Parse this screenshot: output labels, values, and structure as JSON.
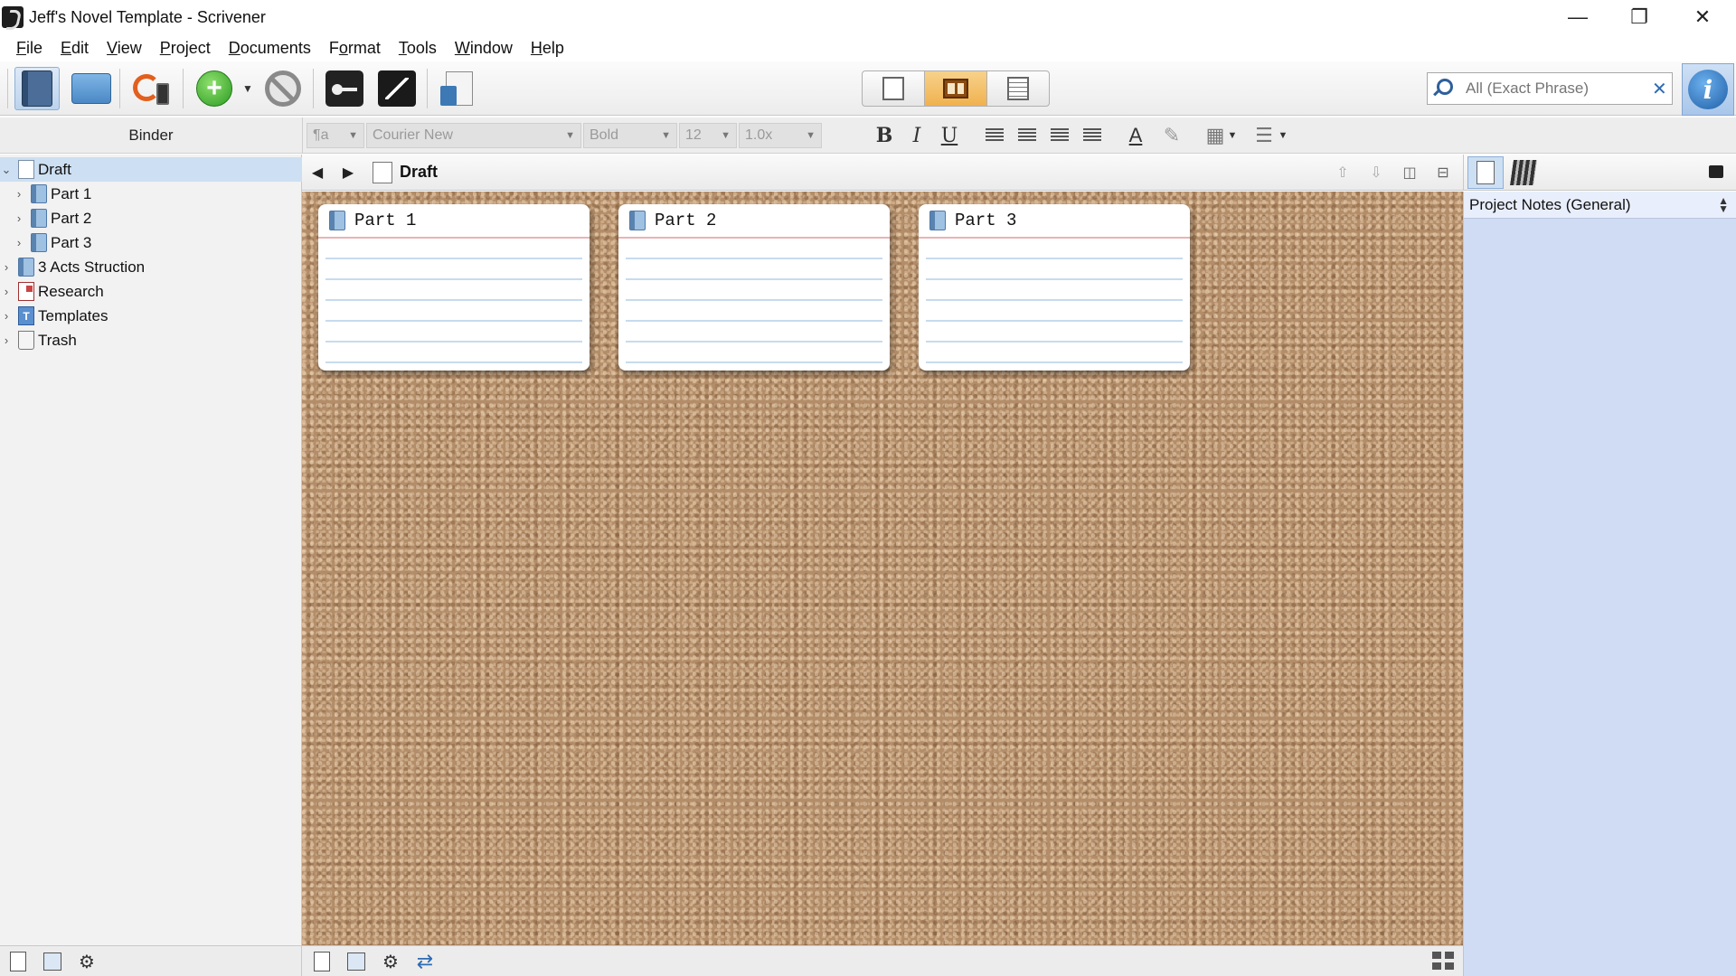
{
  "window": {
    "title": "Jeff's Novel Template - Scrivener",
    "controls": {
      "minimize": "—",
      "maximize": "❐",
      "close": "✕"
    }
  },
  "menu": [
    {
      "pre": "",
      "u": "F",
      "post": "ile"
    },
    {
      "pre": "",
      "u": "E",
      "post": "dit"
    },
    {
      "pre": "",
      "u": "V",
      "post": "iew"
    },
    {
      "pre": "",
      "u": "P",
      "post": "roject"
    },
    {
      "pre": "",
      "u": "D",
      "post": "ocuments"
    },
    {
      "pre": "F",
      "u": "o",
      "post": "rmat"
    },
    {
      "pre": "",
      "u": "T",
      "post": "ools"
    },
    {
      "pre": "",
      "u": "W",
      "post": "indow"
    },
    {
      "pre": "",
      "u": "H",
      "post": "elp"
    }
  ],
  "toolbar": {
    "search": {
      "placeholder": "All (Exact Phrase)",
      "clear": "✕"
    }
  },
  "formatbar": {
    "style": "¶a",
    "font": "Courier New",
    "typeface": "Bold",
    "size": "12",
    "line_spacing": "1.0x",
    "bold": "B",
    "italic": "I",
    "underline": "U"
  },
  "binder": {
    "header": "Binder",
    "items": [
      {
        "label": "Draft",
        "expand": "⌄"
      },
      {
        "label": "Part 1",
        "expand": "›"
      },
      {
        "label": "Part 2",
        "expand": "›"
      },
      {
        "label": "Part 3",
        "expand": "›"
      },
      {
        "label": "3 Acts Struction",
        "expand": "›"
      },
      {
        "label": "Research",
        "expand": "›"
      },
      {
        "label": "Templates",
        "expand": "›"
      },
      {
        "label": "Trash",
        "expand": "›"
      }
    ]
  },
  "editor": {
    "title": "Draft",
    "back": "◀",
    "forward": "▶"
  },
  "corkboard": {
    "cards": [
      {
        "title": "Part 1"
      },
      {
        "title": "Part 2"
      },
      {
        "title": "Part 3"
      }
    ]
  },
  "inspector": {
    "notes_selector": "Project Notes (General)"
  },
  "colors": {
    "selection": "#cddff2",
    "inspector_bg": "#cfdcf3",
    "cork": "#b38d69",
    "accent_blue": "#2e6bb3"
  }
}
